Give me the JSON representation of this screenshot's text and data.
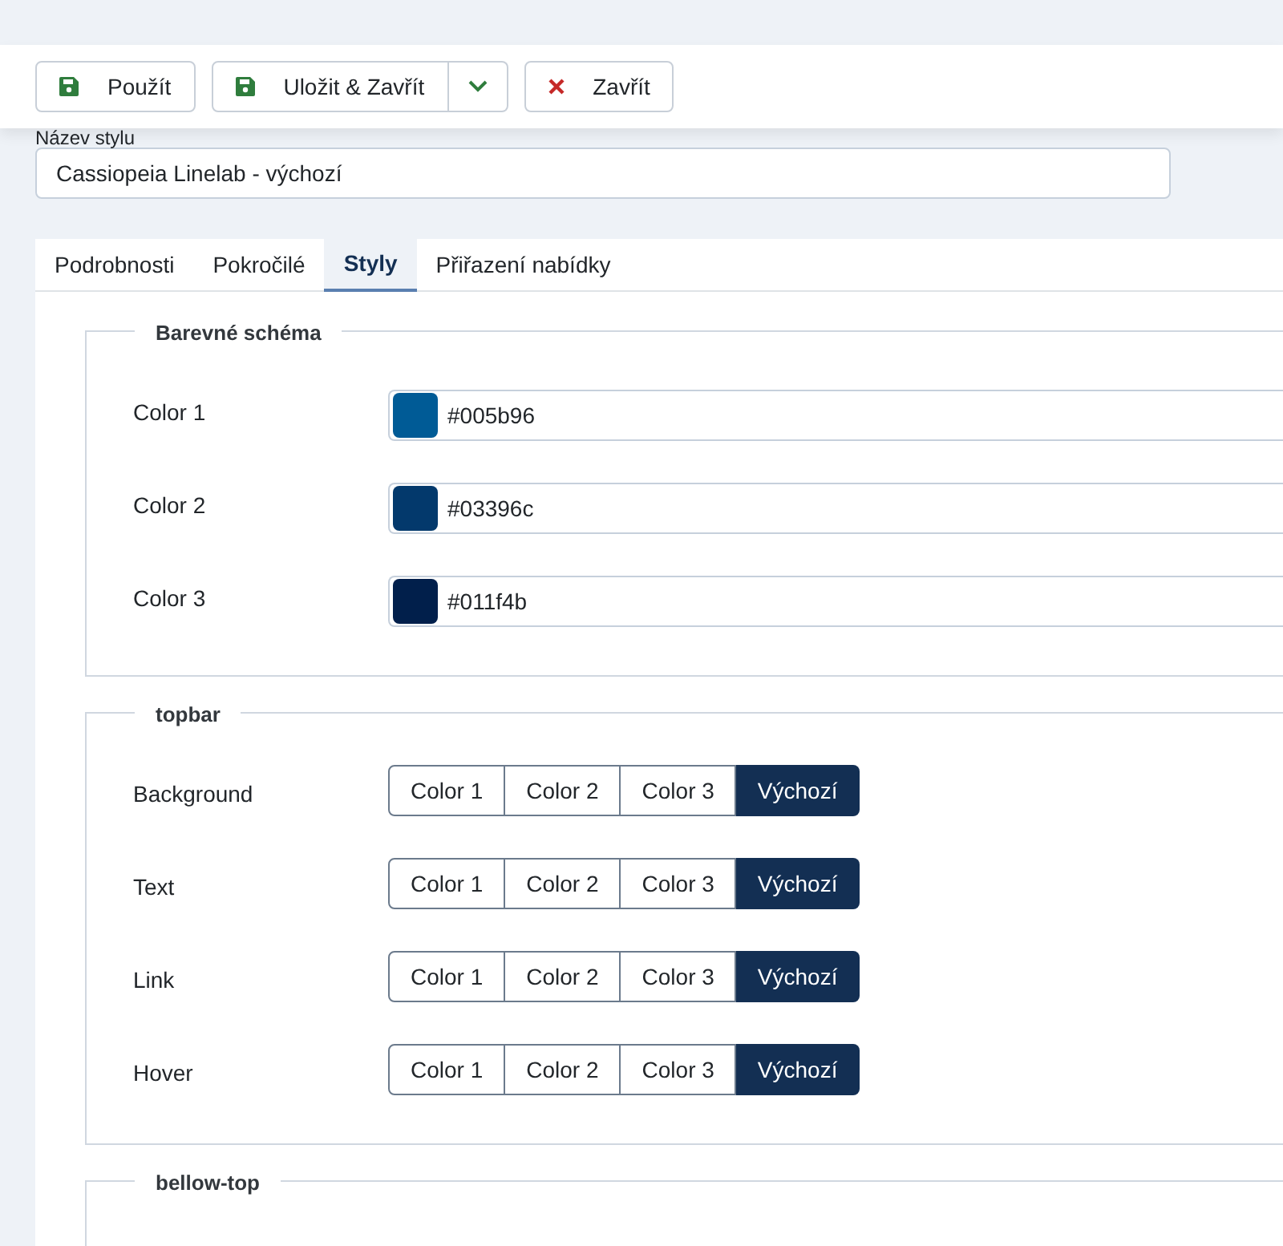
{
  "toolbar": {
    "buttons": [
      {
        "kind": "save",
        "label": "Použít"
      },
      {
        "kind": "save-split",
        "label": "Uložit & Zavřít"
      },
      {
        "kind": "close",
        "label": "Zavřít"
      }
    ]
  },
  "style_name": {
    "label": "Název stylu",
    "value": "Cassiopeia Linelab - výchozí"
  },
  "tabs": [
    {
      "label": "Podrobnosti",
      "selected": false
    },
    {
      "label": "Pokročilé",
      "selected": false
    },
    {
      "label": "Styly",
      "selected": true
    },
    {
      "label": "Přiřazení nabídky",
      "selected": false
    }
  ],
  "fieldsets": [
    {
      "legend": "Barevné schéma",
      "rows": [
        {
          "kind": "color",
          "label": "Color 1",
          "value": "#005b96",
          "color": "#005b96"
        },
        {
          "kind": "color",
          "label": "Color 2",
          "value": "#03396c",
          "color": "#03396c"
        },
        {
          "kind": "color",
          "label": "Color 3",
          "value": "#011f4b",
          "color": "#011f4b"
        }
      ]
    },
    {
      "legend": "topbar",
      "rows": [
        {
          "kind": "choice",
          "label": "Background",
          "options": [
            {
              "label": "Color 1",
              "selected": false
            },
            {
              "label": "Color 2",
              "selected": false
            },
            {
              "label": "Color 3",
              "selected": false
            },
            {
              "label": "Výchozí",
              "selected": true
            }
          ]
        },
        {
          "kind": "choice",
          "label": "Text",
          "options": [
            {
              "label": "Color 1",
              "selected": false
            },
            {
              "label": "Color 2",
              "selected": false
            },
            {
              "label": "Color 3",
              "selected": false
            },
            {
              "label": "Výchozí",
              "selected": true
            }
          ]
        },
        {
          "kind": "choice",
          "label": "Link",
          "options": [
            {
              "label": "Color 1",
              "selected": false
            },
            {
              "label": "Color 2",
              "selected": false
            },
            {
              "label": "Color 3",
              "selected": false
            },
            {
              "label": "Výchozí",
              "selected": true
            }
          ]
        },
        {
          "kind": "choice",
          "label": "Hover",
          "options": [
            {
              "label": "Color 1",
              "selected": false
            },
            {
              "label": "Color 2",
              "selected": false
            },
            {
              "label": "Color 3",
              "selected": false
            },
            {
              "label": "Výchozí",
              "selected": true
            }
          ]
        }
      ]
    },
    {
      "legend": "bellow-top"
    }
  ]
}
